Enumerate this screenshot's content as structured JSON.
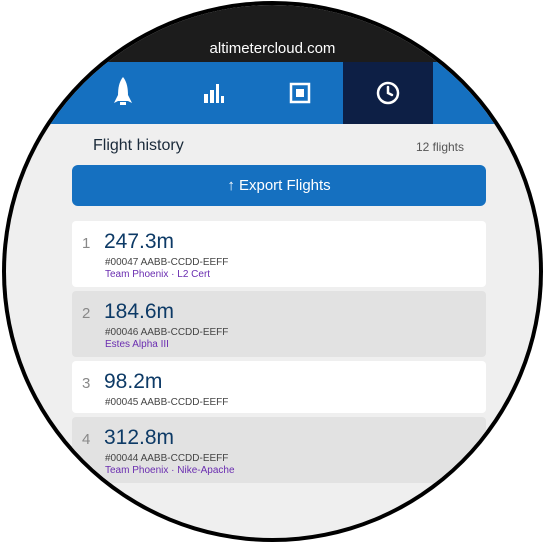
{
  "browser": {
    "url": "altimetercloud.com"
  },
  "tabs": [
    {
      "icon": "rocket-icon",
      "active": false
    },
    {
      "icon": "bar-chart-icon",
      "active": false
    },
    {
      "icon": "square-target-icon",
      "active": false
    },
    {
      "icon": "clock-icon",
      "active": true
    }
  ],
  "header": {
    "title": "Flight history",
    "count": "12 flights"
  },
  "export": {
    "label": "↑ Export Flights"
  },
  "flights": [
    {
      "index": "1",
      "altitude": "247.3m",
      "serial": "#00047 AABB-CCDD-EEFF",
      "tag1": "Team Phoenix",
      "sep": " · ",
      "tag2": "L2 Cert"
    },
    {
      "index": "2",
      "altitude": "184.6m",
      "serial": "#00046 AABB-CCDD-EEFF",
      "tag1": "Estes Alpha III",
      "sep": "",
      "tag2": ""
    },
    {
      "index": "3",
      "altitude": "98.2m",
      "serial": "#00045 AABB-CCDD-EEFF",
      "tag1": "",
      "sep": "",
      "tag2": ""
    },
    {
      "index": "4",
      "altitude": "312.8m",
      "serial": "#00044 AABB-CCDD-EEFF",
      "tag1": "Team Phoenix",
      "sep": " · ",
      "tag2": "Nike-Apache"
    }
  ],
  "colors": {
    "accent": "#1570c0",
    "active_tab": "#0d1f45",
    "tag": "#6a2db0"
  }
}
